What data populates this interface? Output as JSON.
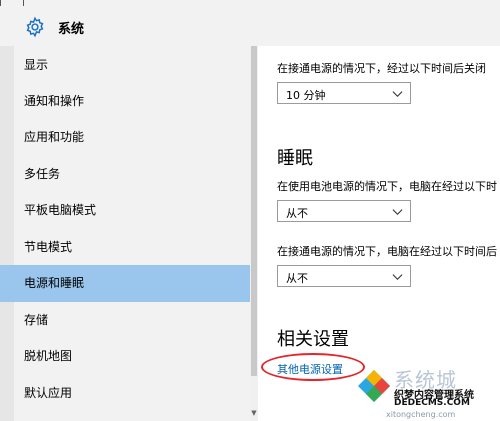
{
  "header": {
    "title": "系统",
    "icon": "gear-icon"
  },
  "sidebar": {
    "items": [
      {
        "label": "显示",
        "selected": false
      },
      {
        "label": "通知和操作",
        "selected": false
      },
      {
        "label": "应用和功能",
        "selected": false
      },
      {
        "label": "多任务",
        "selected": false
      },
      {
        "label": "平板电脑模式",
        "selected": false
      },
      {
        "label": "节电模式",
        "selected": false
      },
      {
        "label": "电源和睡眠",
        "selected": true
      },
      {
        "label": "存储",
        "selected": false
      },
      {
        "label": "脱机地图",
        "selected": false
      },
      {
        "label": "默认应用",
        "selected": false
      }
    ]
  },
  "content": {
    "screen_plugged_desc": "在接通电源的情况下，经过以下时间后关闭",
    "screen_plugged_value": "10 分钟",
    "sleep_title": "睡眠",
    "sleep_battery_desc": "在使用电池电源的情况下，电脑在经过以下时",
    "sleep_battery_value": "从不",
    "sleep_plugged_desc": "在接通电源的情况下，电脑在经过以下时间后",
    "sleep_plugged_value": "从不",
    "related_title": "相关设置",
    "other_power_link": "其他电源设置"
  },
  "watermark": {
    "big": "系统城",
    "cn": "织梦内容管理系统",
    "url": "DEDECMS.COM",
    "small": "xitongcheng.com"
  },
  "colors": {
    "accent_selected": "#9ac6ee",
    "link": "#0063b1",
    "highlight_ring": "#e2262b"
  }
}
